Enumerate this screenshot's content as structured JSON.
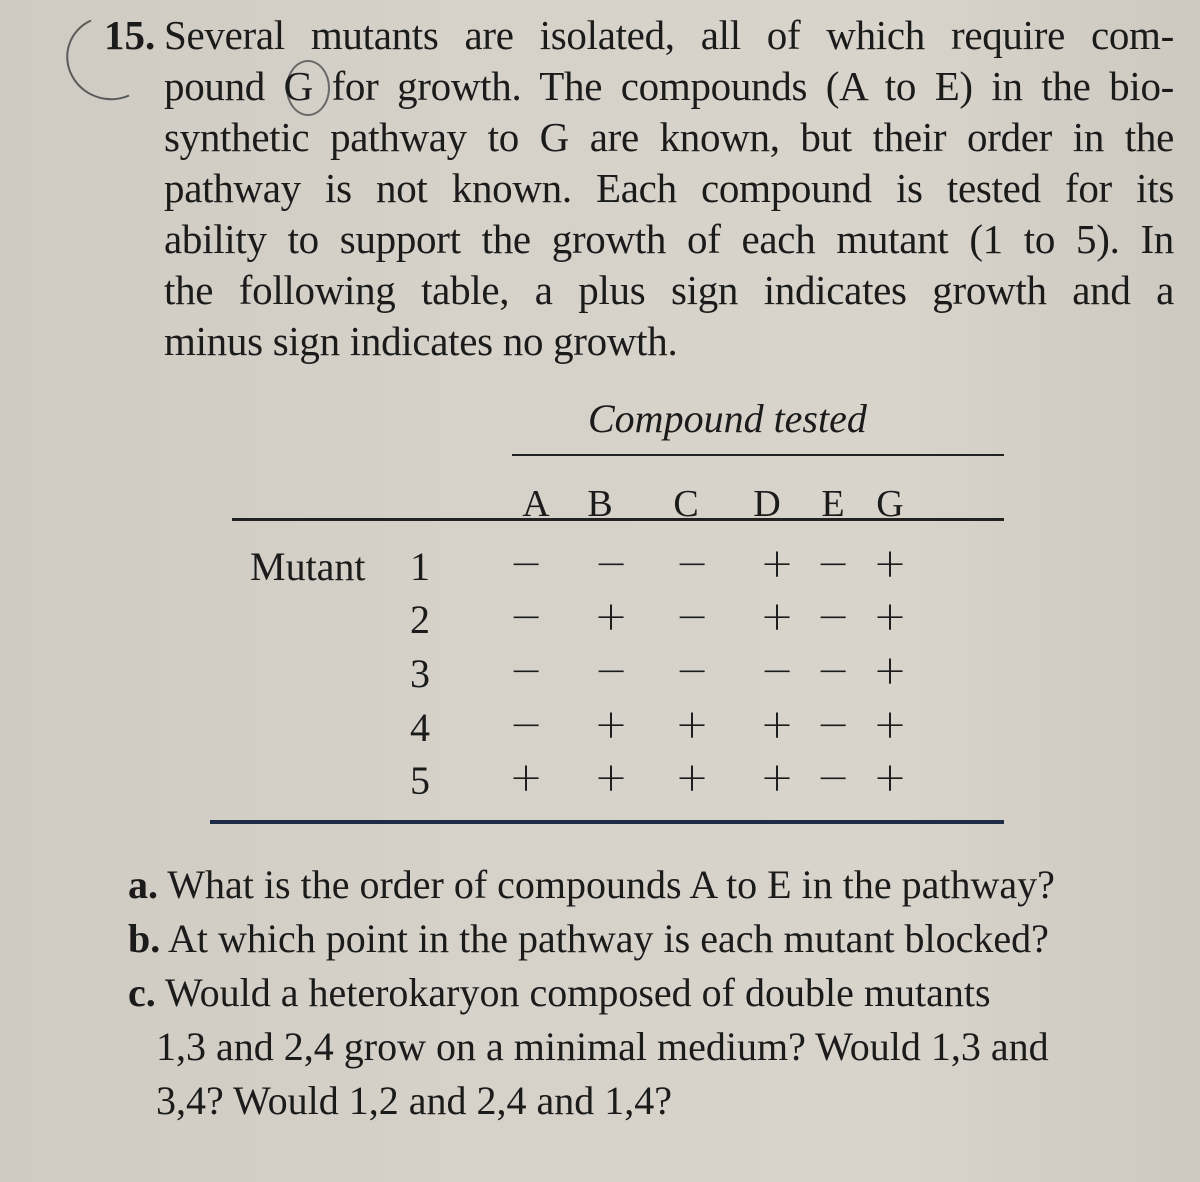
{
  "problem": {
    "number": "15.",
    "lines": [
      "Several mutants are isolated, all of which require com-",
      "pound G for growth. The compounds (A to E) in the bio-",
      "synthetic pathway to G are known, but their order in the",
      "pathway is not known. Each compound is tested for its",
      "ability to support the growth of each mutant (1 to 5). In",
      "the following table, a plus sign indicates growth and a",
      "minus sign indicates no growth."
    ]
  },
  "table": {
    "title": "Compound tested",
    "row_header": "Mutant",
    "columns": [
      "A",
      "B",
      "C",
      "D",
      "E",
      "G"
    ],
    "rows": [
      {
        "mutant": "1",
        "values": [
          "−",
          "−",
          "−",
          "+",
          "−",
          "+"
        ]
      },
      {
        "mutant": "2",
        "values": [
          "−",
          "+",
          "−",
          "+",
          "−",
          "+"
        ]
      },
      {
        "mutant": "3",
        "values": [
          "−",
          "−",
          "−",
          "−",
          "−",
          "+"
        ]
      },
      {
        "mutant": "4",
        "values": [
          "−",
          "+",
          "+",
          "+",
          "−",
          "+"
        ]
      },
      {
        "mutant": "5",
        "values": [
          "+",
          "+",
          "+",
          "+",
          "−",
          "+"
        ]
      }
    ]
  },
  "questions": [
    {
      "letter": "a.",
      "lines": [
        "What is the order of compounds A to E in the pathway?"
      ]
    },
    {
      "letter": "b.",
      "lines": [
        "At which point in the pathway is each mutant blocked?"
      ]
    },
    {
      "letter": "c.",
      "lines": [
        "Would a heterokaryon composed of double mutants",
        "1,3 and 2,4 grow on a minimal medium? Would 1,3 and",
        "3,4? Would 1,2 and 2,4 and 1,4?"
      ]
    }
  ]
}
